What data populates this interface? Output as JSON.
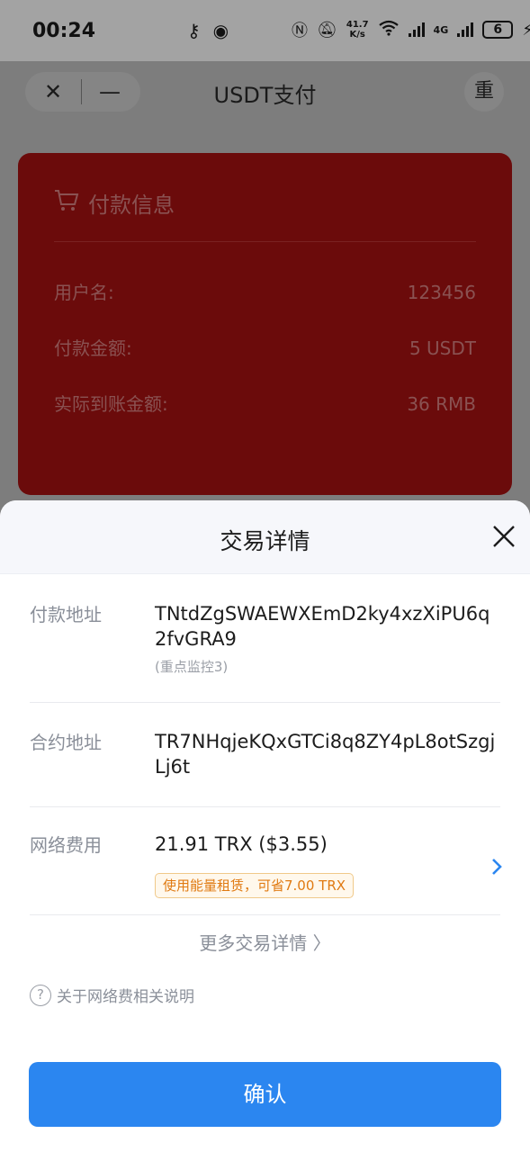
{
  "status_bar": {
    "time": "00:24",
    "net_speed_value": "41.7",
    "net_speed_unit": "K/s",
    "network": "4G",
    "battery": "6"
  },
  "page": {
    "title": "USDT支付",
    "close_label": "✕",
    "minimize_label": "—",
    "refresh_label": "重",
    "card": {
      "heading": "付款信息",
      "rows": [
        {
          "key": "用户名:",
          "value": "123456"
        },
        {
          "key": "付款金额:",
          "value": "5 USDT"
        },
        {
          "key": "实际到账金额:",
          "value": "36 RMB"
        }
      ],
      "bg_color": "#6b0b0b"
    }
  },
  "sheet": {
    "title": "交易详情",
    "payment_address": {
      "label": "付款地址",
      "value": "TNtdZgSWAEWXEmD2ky4xzXiPU6q2fvGRA9",
      "note": "(重点监控3)"
    },
    "contract_address": {
      "label": "合约地址",
      "value": "TR7NHqjeKQxGTCi8q8ZY4pL8otSzgjLj6t"
    },
    "network_fee": {
      "label": "网络费用",
      "value": "21.91 TRX ($3.55)",
      "tag": "使用能量租赁，可省7.00 TRX"
    },
    "more_details": "更多交易详情 〉",
    "help_text": "关于网络费相关说明",
    "confirm_label": "确认"
  },
  "colors": {
    "primary": "#2b86f0",
    "tag_orange": "#e07a12",
    "chevron_blue": "#2b86f0"
  }
}
